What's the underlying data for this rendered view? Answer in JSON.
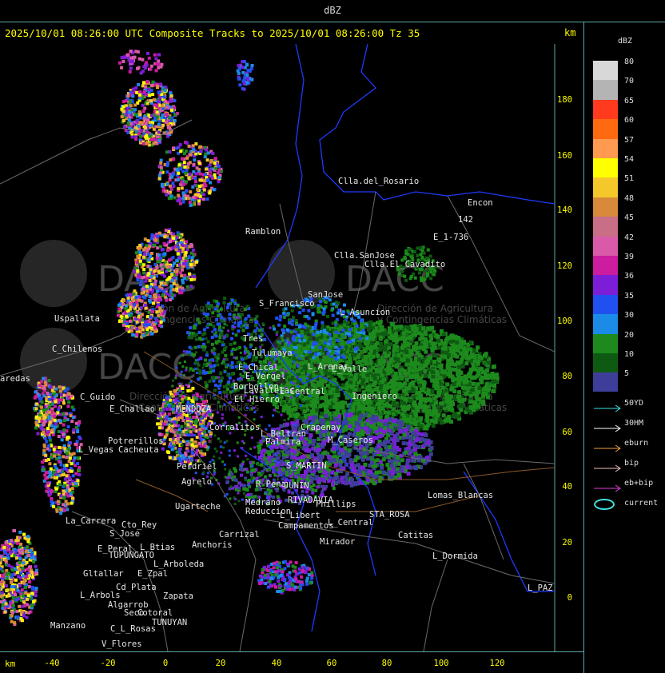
{
  "header": {
    "units_title": "dBZ",
    "headline": "2025/10/01 08:26:00 UTC Composite Tracks to 2025/10/01 08:26:00 Tz 35",
    "km_label_top": "km",
    "km_label_bottom": "km"
  },
  "axes": {
    "x_ticks": [
      "-40",
      "-20",
      "0",
      "20",
      "40",
      "60",
      "80",
      "100",
      "120"
    ],
    "y_ticks": [
      "180",
      "160",
      "140",
      "120",
      "100",
      "80",
      "60",
      "40",
      "20",
      "0"
    ]
  },
  "legend": {
    "title": "dBZ",
    "scale": [
      {
        "label": "80",
        "color": "#d8d8d8"
      },
      {
        "label": "70",
        "color": "#b4b4b4"
      },
      {
        "label": "65",
        "color": "#ff3a1e"
      },
      {
        "label": "60",
        "color": "#ff6a10"
      },
      {
        "label": "57",
        "color": "#ff9a50"
      },
      {
        "label": "54",
        "color": "#ffff00"
      },
      {
        "label": "51",
        "color": "#f4c82a"
      },
      {
        "label": "48",
        "color": "#d88a3a"
      },
      {
        "label": "45",
        "color": "#c86e86"
      },
      {
        "label": "42",
        "color": "#d95aa8"
      },
      {
        "label": "39",
        "color": "#cc1ca0"
      },
      {
        "label": "36",
        "color": "#7c1ed8"
      },
      {
        "label": "35",
        "color": "#2050f0"
      },
      {
        "label": "30",
        "color": "#1a8ce8"
      },
      {
        "label": "20",
        "color": "#1c8a1c"
      },
      {
        "label": "10",
        "color": "#0f5a12"
      },
      {
        "label": "5",
        "color": "#3e3e9a"
      }
    ],
    "tracks": [
      {
        "label": "50YD",
        "color": "#40e0e0"
      },
      {
        "label": "30HM",
        "color": "#ffffff"
      },
      {
        "label": "eburn",
        "color": "#f0a040"
      },
      {
        "label": "bip",
        "color": "#f0c0c0"
      },
      {
        "label": "eb+bip",
        "color": "#e040e0"
      },
      {
        "label": "current",
        "color": "#40e0e0"
      }
    ]
  },
  "watermark": {
    "org": "DACC",
    "line1": "Dirección de Agricultura",
    "line2": "y Contingencias Climáticas"
  },
  "places": [
    {
      "name": "Clla.del_Rosario"
    },
    {
      "name": "Encon"
    },
    {
      "name": "142"
    },
    {
      "name": "E_1-736"
    },
    {
      "name": "Ramblon"
    },
    {
      "name": "Clla.SanJose"
    },
    {
      "name": "Clla.El_Cavadito"
    },
    {
      "name": "S_Francisco"
    },
    {
      "name": "SanJose"
    },
    {
      "name": "L_Asuncion"
    },
    {
      "name": "Uspallata"
    },
    {
      "name": "Tres"
    },
    {
      "name": "Tulumaya"
    },
    {
      "name": "C_Chilenos"
    },
    {
      "name": "E_Chical"
    },
    {
      "name": "E_Vergel"
    },
    {
      "name": "L_Arenas"
    },
    {
      "name": "L_Valle"
    },
    {
      "name": "aredas"
    },
    {
      "name": "Borbollon"
    },
    {
      "name": "Lavallelas"
    },
    {
      "name": "El_Hierro"
    },
    {
      "name": "E_Central"
    },
    {
      "name": "Ingeniero"
    },
    {
      "name": "C_Guido"
    },
    {
      "name": "E_Challao"
    },
    {
      "name": "MENDOZA"
    },
    {
      "name": "Corralitos"
    },
    {
      "name": "Crapenay"
    },
    {
      "name": "Potrerillos"
    },
    {
      "name": "Cacheuta"
    },
    {
      "name": "L_Vegas"
    },
    {
      "name": "Perdriel"
    },
    {
      "name": "Agrelo"
    },
    {
      "name": "L_Beltran"
    },
    {
      "name": "Palmira"
    },
    {
      "name": "M_Caseros"
    },
    {
      "name": "S_MARTIN"
    },
    {
      "name": "Ugarteche"
    },
    {
      "name": "R_Pena"
    },
    {
      "name": "JUNIN"
    },
    {
      "name": "Medrano"
    },
    {
      "name": "Reduccion"
    },
    {
      "name": "Phillips"
    },
    {
      "name": "L_Libert"
    },
    {
      "name": "RIVADAVIA"
    },
    {
      "name": "STA_ROSA"
    },
    {
      "name": "Lomas_Blancas"
    },
    {
      "name": "La_Carrera"
    },
    {
      "name": "Cto_Rey"
    },
    {
      "name": "S_Jose"
    },
    {
      "name": "Carrizal"
    },
    {
      "name": "Campamentos"
    },
    {
      "name": "L_Central"
    },
    {
      "name": "Catitas"
    },
    {
      "name": "E_Peral"
    },
    {
      "name": "L_Btias"
    },
    {
      "name": "Anchoris"
    },
    {
      "name": "TUPUNGATO"
    },
    {
      "name": "Mirador"
    },
    {
      "name": "L_Dormida"
    },
    {
      "name": "L_Arboleda"
    },
    {
      "name": "Gltallar"
    },
    {
      "name": "E_Zpal"
    },
    {
      "name": "Cd_Plata"
    },
    {
      "name": "L_Arbols"
    },
    {
      "name": "Zapata"
    },
    {
      "name": "Algarrob"
    },
    {
      "name": "Seco"
    },
    {
      "name": "Cotoral"
    },
    {
      "name": "TUNUYAN"
    },
    {
      "name": "Manzano"
    },
    {
      "name": "C_L_Rosas"
    },
    {
      "name": "V_Flores"
    },
    {
      "name": "L_PAZ"
    }
  ]
}
